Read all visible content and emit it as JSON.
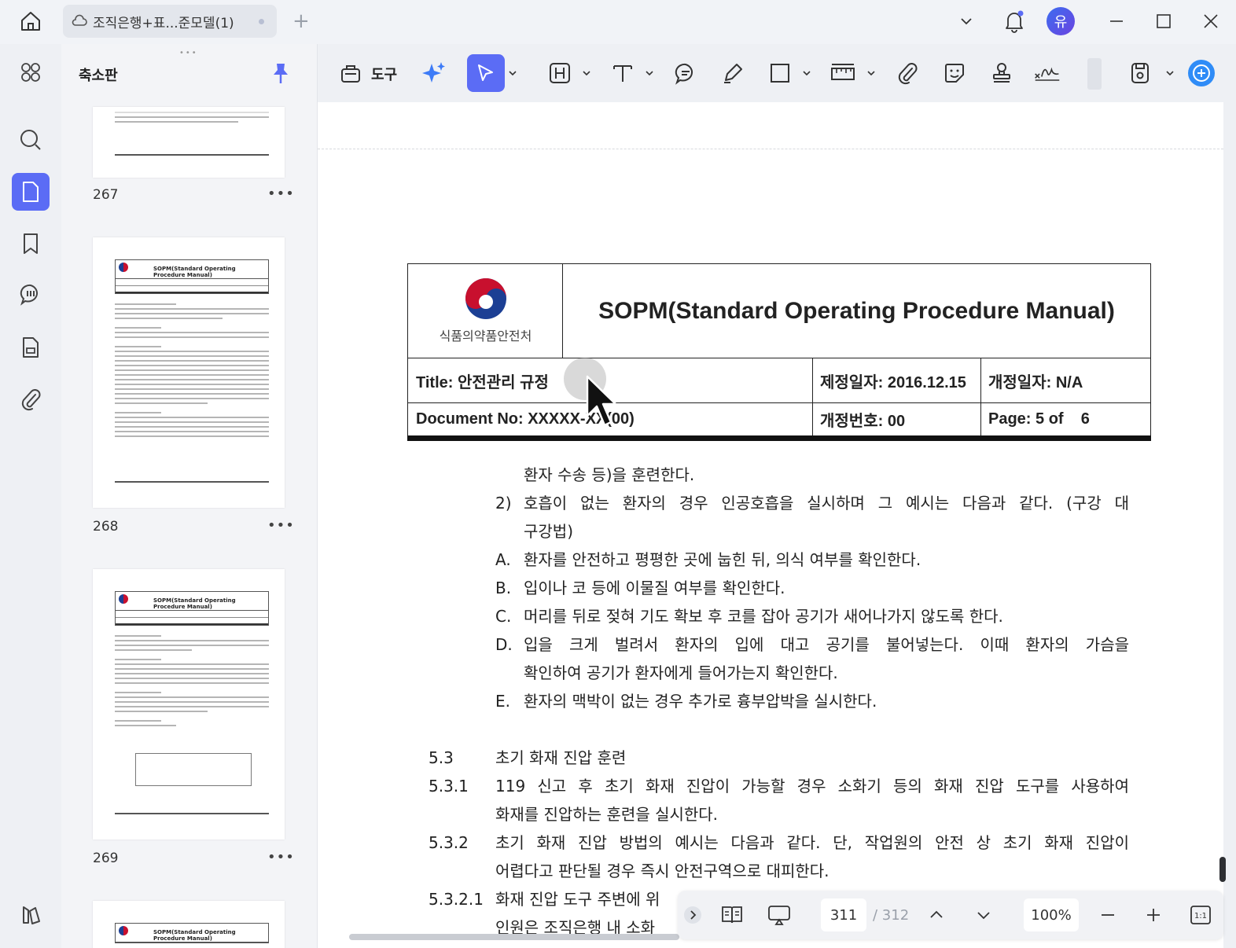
{
  "topbar": {
    "tab_title": "조직은행+표...준모델(1)",
    "new_tab": "+",
    "avatar_letter": "유"
  },
  "panel": {
    "title": "축소판",
    "grip": "•••",
    "thumbnails": [
      {
        "number": "267",
        "more": "•••"
      },
      {
        "number": "268",
        "more": "•••"
      },
      {
        "number": "269",
        "more": "•••"
      },
      {
        "number": "",
        "more": ""
      }
    ],
    "thumb_heading": "SOPM(Standard Operating Procedure Manual)"
  },
  "toolbar": {
    "tools_label": "도구",
    "colors": {
      "accent": "#5b6cf5"
    }
  },
  "document": {
    "org_name": "식품의약품안전처",
    "main_title": "SOPM(Standard Operating Procedure Manual)",
    "title_label": "Title:  안전관리 규정",
    "enact_date": "제정일자: 2016.12.15",
    "revise_date": "개정일자: N/A",
    "doc_no": "Document No: XXXXX-XX(00)",
    "revision_no": "개정번호: 00",
    "page_info": "Page: 5 of    6",
    "lines": {
      "l1": "환자 수송 등)을 훈련한다.",
      "l2_num": "2)",
      "l2a": "호흡이 없는 환자의 경우 인공호흡을 실시하며 그 예시는 다음과 같다. (구강 대",
      "l2b": "구강법)",
      "a_num": "A.",
      "a": "환자를 안전하고 평평한 곳에 눕힌 뒤, 의식 여부를 확인한다.",
      "b_num": "B.",
      "b": "입이나 코 등에 이물질 여부를 확인한다.",
      "c_num": "C.",
      "c": "머리를 뒤로 젖혀 기도 확보 후 코를 잡아 공기가 새어나가지 않도록 한다.",
      "d_num": "D.",
      "d1": "입을 크게 벌려서 환자의 입에 대고 공기를 불어넣는다. 이때 환자의 가슴을",
      "d2": "확인하여 공기가 환자에게 들어가는지 확인한다.",
      "e_num": "E.",
      "e": "환자의 맥박이 없는 경우 추가로 흉부압박을 실시한다.",
      "s53_num": "5.3",
      "s53": "초기 화재 진압 훈련",
      "s531_num": "5.3.1",
      "s531a": "119 신고 후 초기 화재 진압이 가능할 경우 소화기 등의 화재 진압 도구를 사용하여",
      "s531b": "화재를 진압하는 훈련을 실시한다.",
      "s532_num": "5.3.2",
      "s532a": "초기 화재 진압 방법의 예시는 다음과 같다. 단, 작업원의 안전 상 초기 화재 진압이",
      "s532b": "어렵다고 판단될 경우 즉시 안전구역으로 대피한다.",
      "s5321_num": "5.3.2.1",
      "s5321a": "화재 진압 도구 주변에 위",
      "s5321b": "인원은 조직은행 내 소화"
    }
  },
  "bottombar": {
    "current_page": "311",
    "total_pages": "/ 312",
    "zoom": "100%"
  }
}
